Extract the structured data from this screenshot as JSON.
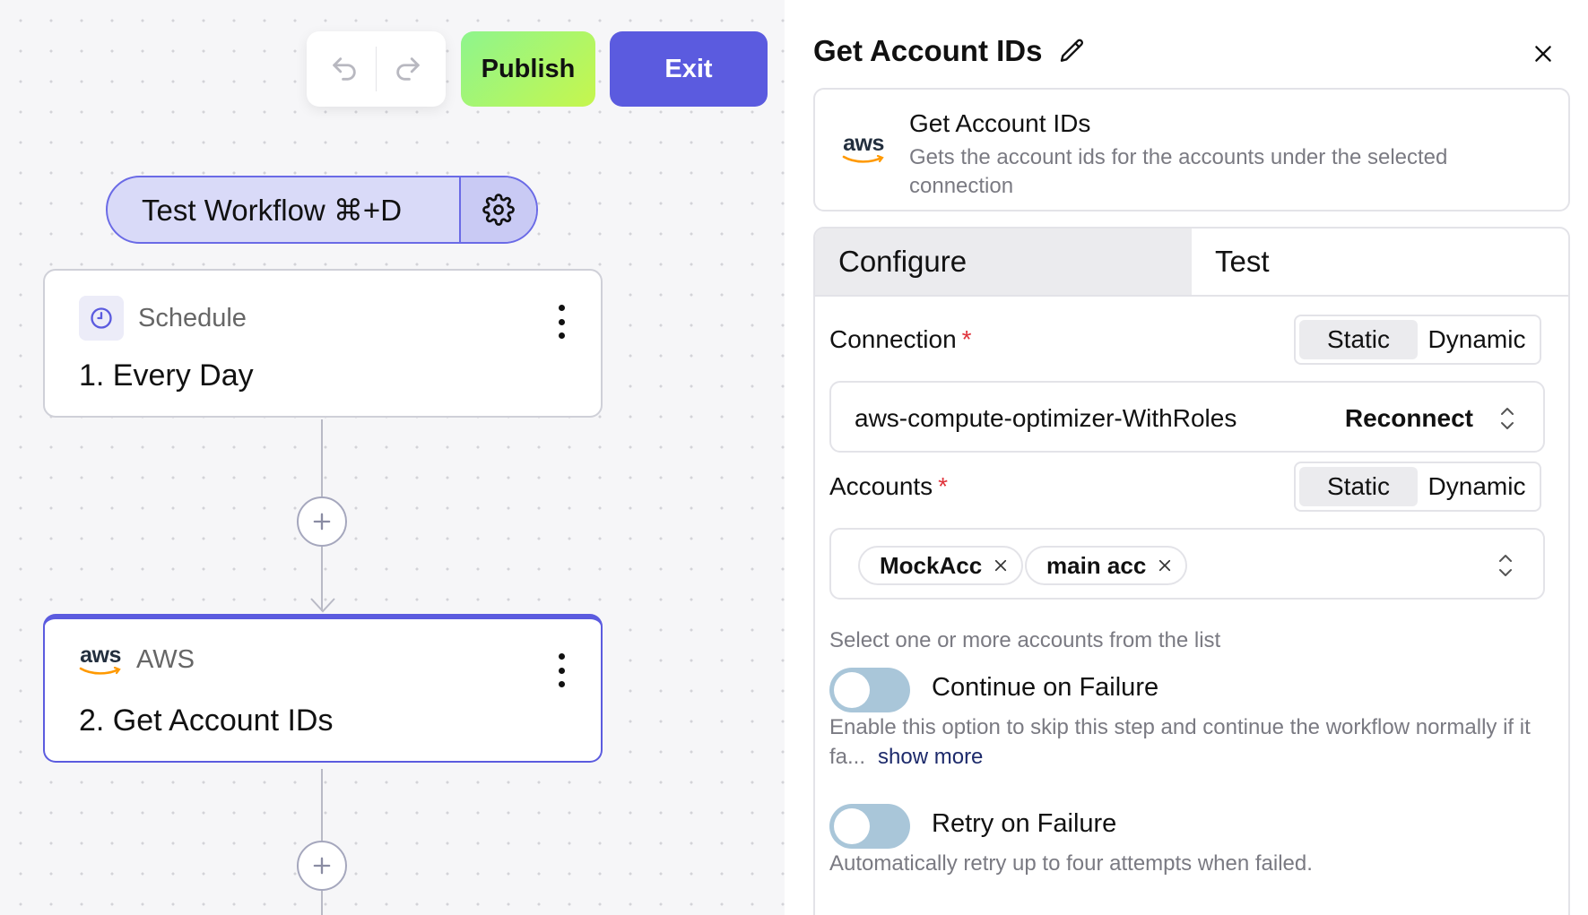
{
  "canvas": {
    "publish_label": "Publish",
    "exit_label": "Exit",
    "test_workflow_label": "Test Workflow ⌘+D",
    "nodes": [
      {
        "app": "Schedule",
        "title": "1. Every Day",
        "icon": "clock-icon"
      },
      {
        "app": "AWS",
        "title": "2. Get Account IDs",
        "icon": "aws-logo",
        "logo_text": "aws"
      }
    ]
  },
  "panel": {
    "title": "Get Account IDs",
    "info": {
      "logo_text": "aws",
      "name": "Get Account IDs",
      "description": "Gets the account ids for the accounts under the selected connection"
    },
    "tabs": [
      "Configure",
      "Test"
    ],
    "active_tab": "Configure",
    "connection": {
      "label": "Connection",
      "required_mark": "*",
      "mode_options": [
        "Static",
        "Dynamic"
      ],
      "mode_selected": "Static",
      "value": "aws-compute-optimizer-WithRoles",
      "action_label": "Reconnect"
    },
    "accounts": {
      "label": "Accounts",
      "required_mark": "*",
      "mode_options": [
        "Static",
        "Dynamic"
      ],
      "mode_selected": "Static",
      "selected": [
        "MockAcc",
        "main acc"
      ],
      "hint": "Select one or more accounts from the list"
    },
    "continue_on_failure": {
      "label": "Continue on Failure",
      "enabled": false,
      "description": "Enable this option to skip this step and continue the workflow normally if it fa...",
      "show_more_label": "show more"
    },
    "retry_on_failure": {
      "label": "Retry on Failure",
      "enabled": false,
      "description": "Automatically retry up to four attempts when failed."
    }
  },
  "colors": {
    "accent": "#5b5bdf",
    "publish_gradient_start": "#8ef58d",
    "publish_gradient_end": "#c6f64d",
    "aws_orange": "#ff9900",
    "required": "#e0333b",
    "toggle_off": "#a9c6d9"
  }
}
